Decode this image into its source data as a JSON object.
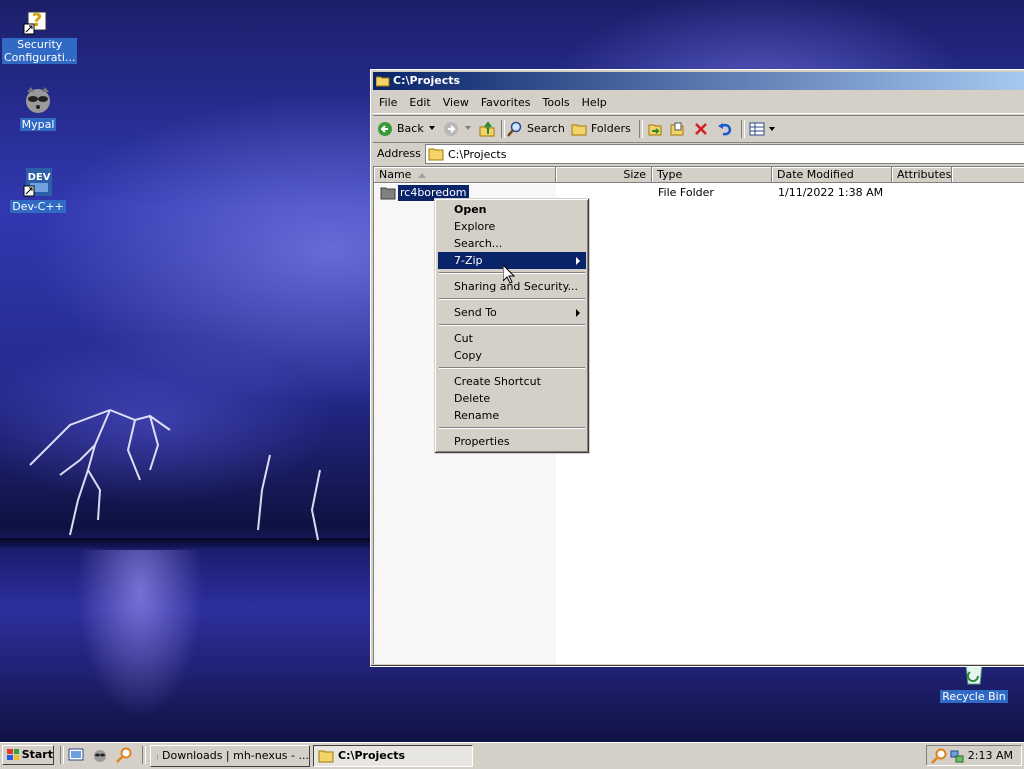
{
  "desktop": {
    "icons": [
      {
        "label_line1": "Security",
        "label_line2": "Configurati...",
        "icon": "security-config-icon"
      },
      {
        "label": "Mypal",
        "icon": "mypal-raccoon-icon"
      },
      {
        "label": "Dev-C++",
        "icon": "devcpp-icon"
      },
      {
        "label": "Recycle Bin",
        "icon": "recycle-bin-icon"
      }
    ]
  },
  "window": {
    "title": "C:\\Projects",
    "menu": [
      "File",
      "Edit",
      "View",
      "Favorites",
      "Tools",
      "Help"
    ],
    "toolbar": {
      "back": "Back",
      "search": "Search",
      "folders": "Folders"
    },
    "address": {
      "label": "Address",
      "value": "C:\\Projects"
    },
    "columns": [
      "Name",
      "Size",
      "Type",
      "Date Modified",
      "Attributes"
    ],
    "files": [
      {
        "name": "rc4boredom",
        "size": "",
        "type": "File Folder",
        "modified": "1/11/2022 1:38 AM",
        "attributes": ""
      }
    ]
  },
  "context_menu": {
    "items": [
      "Open",
      "Explore",
      "Search...",
      "7-Zip",
      "Sharing and Security...",
      "Send To",
      "Cut",
      "Copy",
      "Create Shortcut",
      "Delete",
      "Rename",
      "Properties"
    ],
    "highlighted": "7-Zip"
  },
  "taskbar": {
    "start": "Start",
    "buttons": [
      "Downloads | mh-nexus - ...",
      "C:\\Projects"
    ],
    "clock": "2:13 AM"
  },
  "colors": {
    "selection": "#0a246a",
    "face": "#d4d0c8",
    "desktop": "#1a1f5e"
  }
}
